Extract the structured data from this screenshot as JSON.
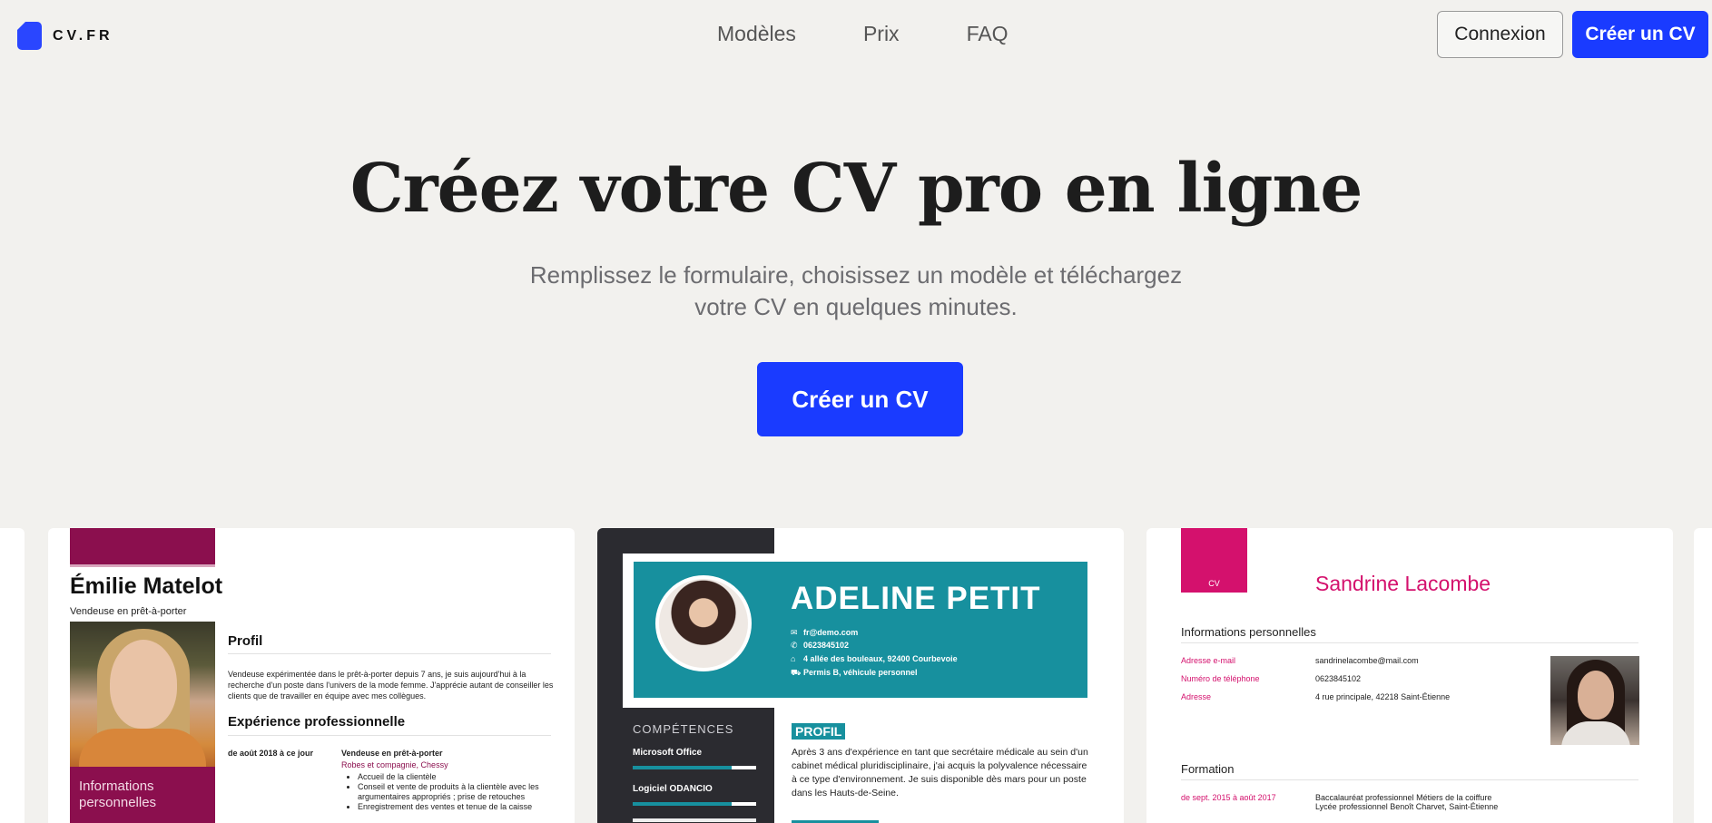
{
  "header": {
    "logo_text": "CV.FR",
    "nav": [
      "Modèles",
      "Prix",
      "FAQ"
    ],
    "login_label": "Connexion",
    "create_label": "Créer un CV"
  },
  "hero": {
    "title": "Créez votre CV pro en ligne",
    "subtitle_line1": "Remplissez le formulaire, choisissez un modèle et téléchargez",
    "subtitle_line2": "votre CV en quelques minutes.",
    "cta_label": "Créer un CV"
  },
  "templates": {
    "emilie": {
      "name": "Émilie Matelot",
      "role": "Vendeuse en prêt-à-porter",
      "side_heading": "Informations personnelles",
      "profile_heading": "Profil",
      "profile_text": "Vendeuse expérimentée dans le prêt-à-porter depuis 7 ans, je suis aujourd'hui à la recherche d'un poste dans l'univers de la mode femme. J'apprécie autant de conseiller les clients que de travailler en équipe avec mes collègues.",
      "experience_heading": "Expérience professionnelle",
      "job_date": "de août 2018 à ce jour",
      "job_title": "Vendeuse en prêt-à-porter",
      "job_company": "Robes et compagnie, Chessy",
      "job_tasks": [
        "Accueil de la clientèle",
        "Conseil et vente de produits à la clientèle avec les argumentaires appropriés ; prise de retouches",
        "Enregistrement des ventes et tenue de la caisse"
      ]
    },
    "adeline": {
      "name": "ADELINE PETIT",
      "email": "fr@demo.com",
      "phone": "0623845102",
      "address": "4 allée des bouleaux, 92400 Courbevoie",
      "license": "Permis B, véhicule personnel",
      "skills_heading": "COMPÉTENCES",
      "skills": [
        {
          "name": "Microsoft Office",
          "level": 0.8
        },
        {
          "name": "Logiciel ODANCIO",
          "level": 0.8
        }
      ],
      "profile_heading": "PROFIL",
      "profile_text": "Après 3 ans d'expérience en tant que secrétaire médicale au sein d'un cabinet médical pluridisciplinaire, j'ai acquis la polyvalence nécessaire à ce type d'environnement. Je suis disponible dès mars pour un poste dans les Hauts-de-Seine."
    },
    "sandrine": {
      "badge": "CV",
      "name": "Sandrine Lacombe",
      "info_heading": "Informations personnelles",
      "fields": [
        {
          "label": "Adresse e-mail",
          "value": "sandrinelacombe@mail.com"
        },
        {
          "label": "Numéro de téléphone",
          "value": "0623845102"
        },
        {
          "label": "Adresse",
          "value": "4 rue principale, 42218 Saint-Étienne"
        }
      ],
      "education_heading": "Formation",
      "edu_date": "de sept. 2015 à août 2017",
      "edu_line1": "Baccalauréat professionnel Métiers de la coiffure",
      "edu_line2": "Lycée professionnel Benoît Charvet, Saint-Étienne"
    }
  },
  "colors": {
    "accent": "#1a3bff",
    "background": "#f2f1ee",
    "emilie_brand": "#8b0f4e",
    "adeline_teal": "#17909e",
    "sandrine_pink": "#d4116d"
  }
}
